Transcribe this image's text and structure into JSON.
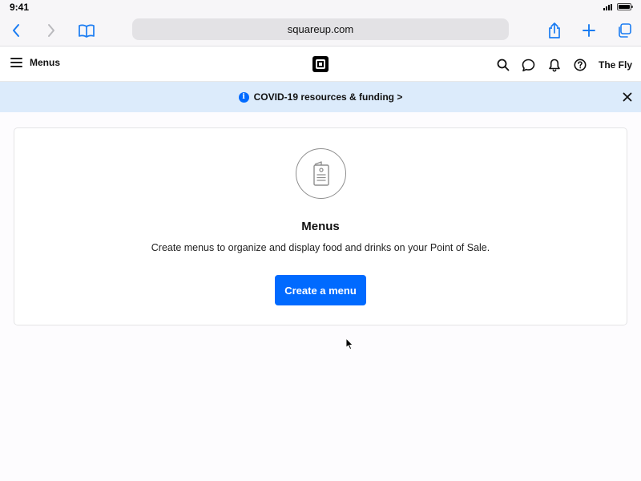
{
  "status_bar": {
    "time": "9:41"
  },
  "browser": {
    "url": "squareup.com",
    "buttons": [
      "back-icon",
      "forward-icon",
      "bookmarks-icon",
      "share-icon",
      "new-tab-icon",
      "tabs-icon"
    ]
  },
  "header": {
    "menu_title": "Menus",
    "business_name": "The Fly",
    "icons": [
      "search-icon",
      "chat-icon",
      "bell-icon",
      "help-icon"
    ]
  },
  "banner": {
    "text": "COVID-19 resources & funding >",
    "info_glyph": "i",
    "color": "#dcebfb"
  },
  "empty_state": {
    "title": "Menus",
    "description": "Create menus to organize and display food and drinks on your Point of Sale.",
    "button_label": "Create a menu",
    "button_color": "#006aff",
    "illustration": "menu-icon"
  }
}
